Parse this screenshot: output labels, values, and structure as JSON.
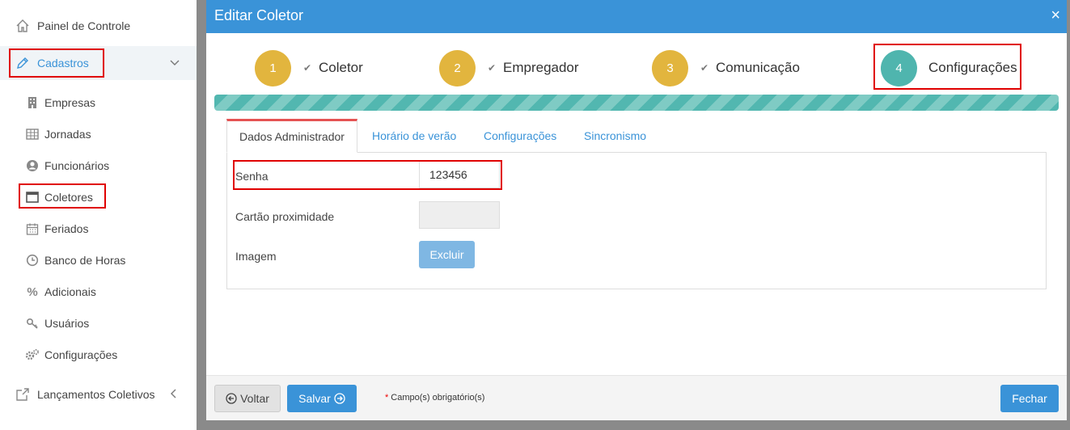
{
  "sidebar": {
    "painel": "Painel de Controle",
    "cadastros": "Cadastros",
    "items": [
      {
        "label": "Empresas"
      },
      {
        "label": "Jornadas"
      },
      {
        "label": "Funcionários"
      },
      {
        "label": "Coletores"
      },
      {
        "label": "Feriados"
      },
      {
        "label": "Banco de Horas"
      },
      {
        "label": "Adicionais"
      },
      {
        "label": "Usuários"
      },
      {
        "label": "Configurações"
      }
    ],
    "lancamentos": "Lançamentos Coletivos"
  },
  "modal": {
    "title": "Editar Coletor",
    "close_glyph": "×",
    "steps": [
      {
        "number": "1",
        "label": "Coletor",
        "done": true
      },
      {
        "number": "2",
        "label": "Empregador",
        "done": true
      },
      {
        "number": "3",
        "label": "Comunicação",
        "done": true
      },
      {
        "number": "4",
        "label": "Configurações",
        "active": true
      }
    ],
    "progress": 1.0,
    "tabs": [
      {
        "label": "Dados Administrador",
        "active": true
      },
      {
        "label": "Horário de verão"
      },
      {
        "label": "Configurações"
      },
      {
        "label": "Sincronismo"
      }
    ],
    "form": {
      "senha_label": "Senha",
      "senha_value": "123456",
      "cartao_label": "Cartão proximidade",
      "cartao_value": "",
      "imagem_label": "Imagem",
      "excluir_label": "Excluir"
    },
    "footer": {
      "voltar_label": "Voltar",
      "salvar_label": "Salvar",
      "required_mark": "*",
      "required_note": "Campo(s) obrigatório(s)",
      "fechar_label": "Fechar"
    }
  },
  "colors": {
    "header_blue": "#3a93d8",
    "step_done": "#e2b53e",
    "step_active": "#4fb5ae",
    "progress_teal": "#52b7b0",
    "highlight_red": "#e00000",
    "tab_active_top": "#e55353"
  }
}
